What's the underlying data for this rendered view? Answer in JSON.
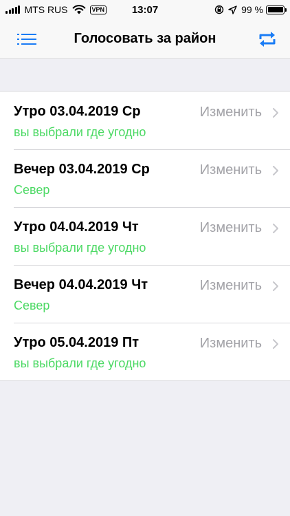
{
  "status": {
    "carrier": "MTS RUS",
    "vpn": "VPN",
    "time": "13:07",
    "battery": "99 %"
  },
  "nav": {
    "title": "Голосовать за район",
    "left_icon": "list-icon",
    "right_icon": "repeat-icon"
  },
  "colors": {
    "accent": "#1a7cf5",
    "subtitle": "#4cd964",
    "action": "#a3a3a8"
  },
  "items": [
    {
      "title": "Утро 03.04.2019 Ср",
      "subtitle": "вы выбрали где угодно",
      "action": "Изменить"
    },
    {
      "title": "Вечер 03.04.2019 Ср",
      "subtitle": "Север",
      "action": "Изменить"
    },
    {
      "title": "Утро 04.04.2019 Чт",
      "subtitle": "вы выбрали где угодно",
      "action": "Изменить"
    },
    {
      "title": "Вечер 04.04.2019 Чт",
      "subtitle": "Север",
      "action": "Изменить"
    },
    {
      "title": "Утро 05.04.2019 Пт",
      "subtitle": "вы выбрали где угодно",
      "action": "Изменить"
    }
  ]
}
